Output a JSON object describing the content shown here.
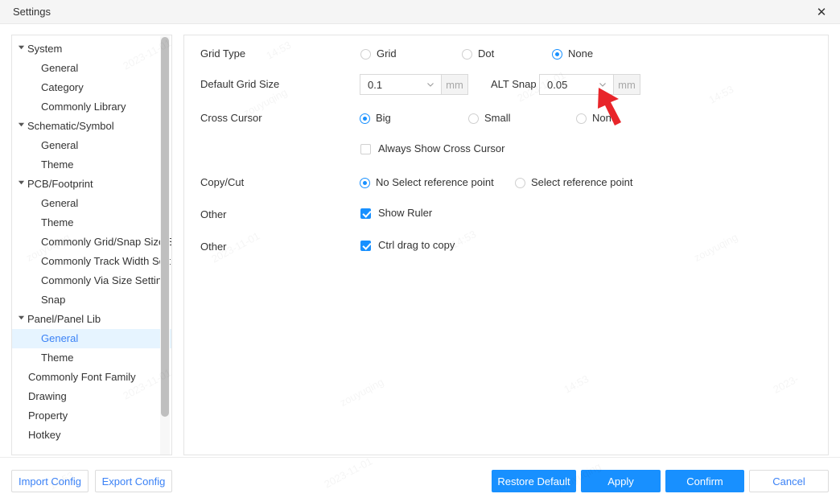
{
  "window": {
    "title": "Settings",
    "close_icon": "close-icon"
  },
  "sidebar": {
    "items": [
      {
        "label": "System",
        "type": "group",
        "expanded": true,
        "selected": false
      },
      {
        "label": "General",
        "type": "child",
        "selected": false
      },
      {
        "label": "Category",
        "type": "child",
        "selected": false
      },
      {
        "label": "Commonly Library",
        "type": "child",
        "selected": false
      },
      {
        "label": "Schematic/Symbol",
        "type": "group",
        "expanded": true,
        "selected": false
      },
      {
        "label": "General",
        "type": "child",
        "selected": false
      },
      {
        "label": "Theme",
        "type": "child",
        "selected": false
      },
      {
        "label": "PCB/Footprint",
        "type": "group",
        "expanded": true,
        "selected": false
      },
      {
        "label": "General",
        "type": "child",
        "selected": false
      },
      {
        "label": "Theme",
        "type": "child",
        "selected": false
      },
      {
        "label": "Commonly Grid/Snap Size S",
        "type": "child",
        "selected": false
      },
      {
        "label": "Commonly Track Width Setti",
        "type": "child",
        "selected": false
      },
      {
        "label": "Commonly Via Size Setting",
        "type": "child",
        "selected": false
      },
      {
        "label": "Snap",
        "type": "child",
        "selected": false
      },
      {
        "label": "Panel/Panel Lib",
        "type": "group",
        "expanded": true,
        "selected": false
      },
      {
        "label": "General",
        "type": "child",
        "selected": true
      },
      {
        "label": "Theme",
        "type": "child",
        "selected": false
      },
      {
        "label": "Commonly Font Family",
        "type": "flat",
        "selected": false
      },
      {
        "label": "Drawing",
        "type": "flat",
        "selected": false
      },
      {
        "label": "Property",
        "type": "flat",
        "selected": false
      },
      {
        "label": "Hotkey",
        "type": "flat",
        "selected": false
      }
    ]
  },
  "main": {
    "grid_type": {
      "label": "Grid Type",
      "options": [
        {
          "label": "Grid",
          "checked": false
        },
        {
          "label": "Dot",
          "checked": false
        },
        {
          "label": "None",
          "checked": true
        }
      ]
    },
    "default_grid_size": {
      "label": "Default Grid Size",
      "value": "0.1",
      "unit": "mm",
      "chevron_icon": "chevron-down-icon"
    },
    "alt_snap": {
      "label": "ALT Snap",
      "value": "0.05",
      "unit": "mm",
      "chevron_icon": "chevron-down-icon"
    },
    "cross_cursor": {
      "label": "Cross Cursor",
      "options": [
        {
          "label": "Big",
          "checked": true
        },
        {
          "label": "Small",
          "checked": false
        },
        {
          "label": "None",
          "checked": false
        }
      ]
    },
    "always_show_cross_cursor": {
      "label": "Always Show Cross Cursor",
      "checked": false
    },
    "copy_cut": {
      "label": "Copy/Cut",
      "options": [
        {
          "label": "No Select reference point",
          "checked": true
        },
        {
          "label": "Select reference point",
          "checked": false
        }
      ]
    },
    "show_ruler": {
      "row_label": "Other",
      "label": "Show Ruler",
      "checked": true
    },
    "ctrl_drag_copy": {
      "row_label": "Other",
      "label": "Ctrl drag to copy",
      "checked": true
    }
  },
  "footer": {
    "import_config": "Import Config",
    "export_config": "Export Config",
    "restore_default": "Restore Default",
    "apply": "Apply",
    "confirm": "Confirm",
    "cancel": "Cancel"
  },
  "annotation": {
    "arrow_color": "#e8252a",
    "arrow_name": "red-pointer-arrow"
  },
  "colors": {
    "accent": "#1890ff",
    "link": "#3b82f6",
    "selected_row_bg": "#e6f4ff",
    "panel_border": "#e4e4e4"
  },
  "watermarks": [
    "2023-11-01",
    "14:53",
    "zouyuqing"
  ]
}
